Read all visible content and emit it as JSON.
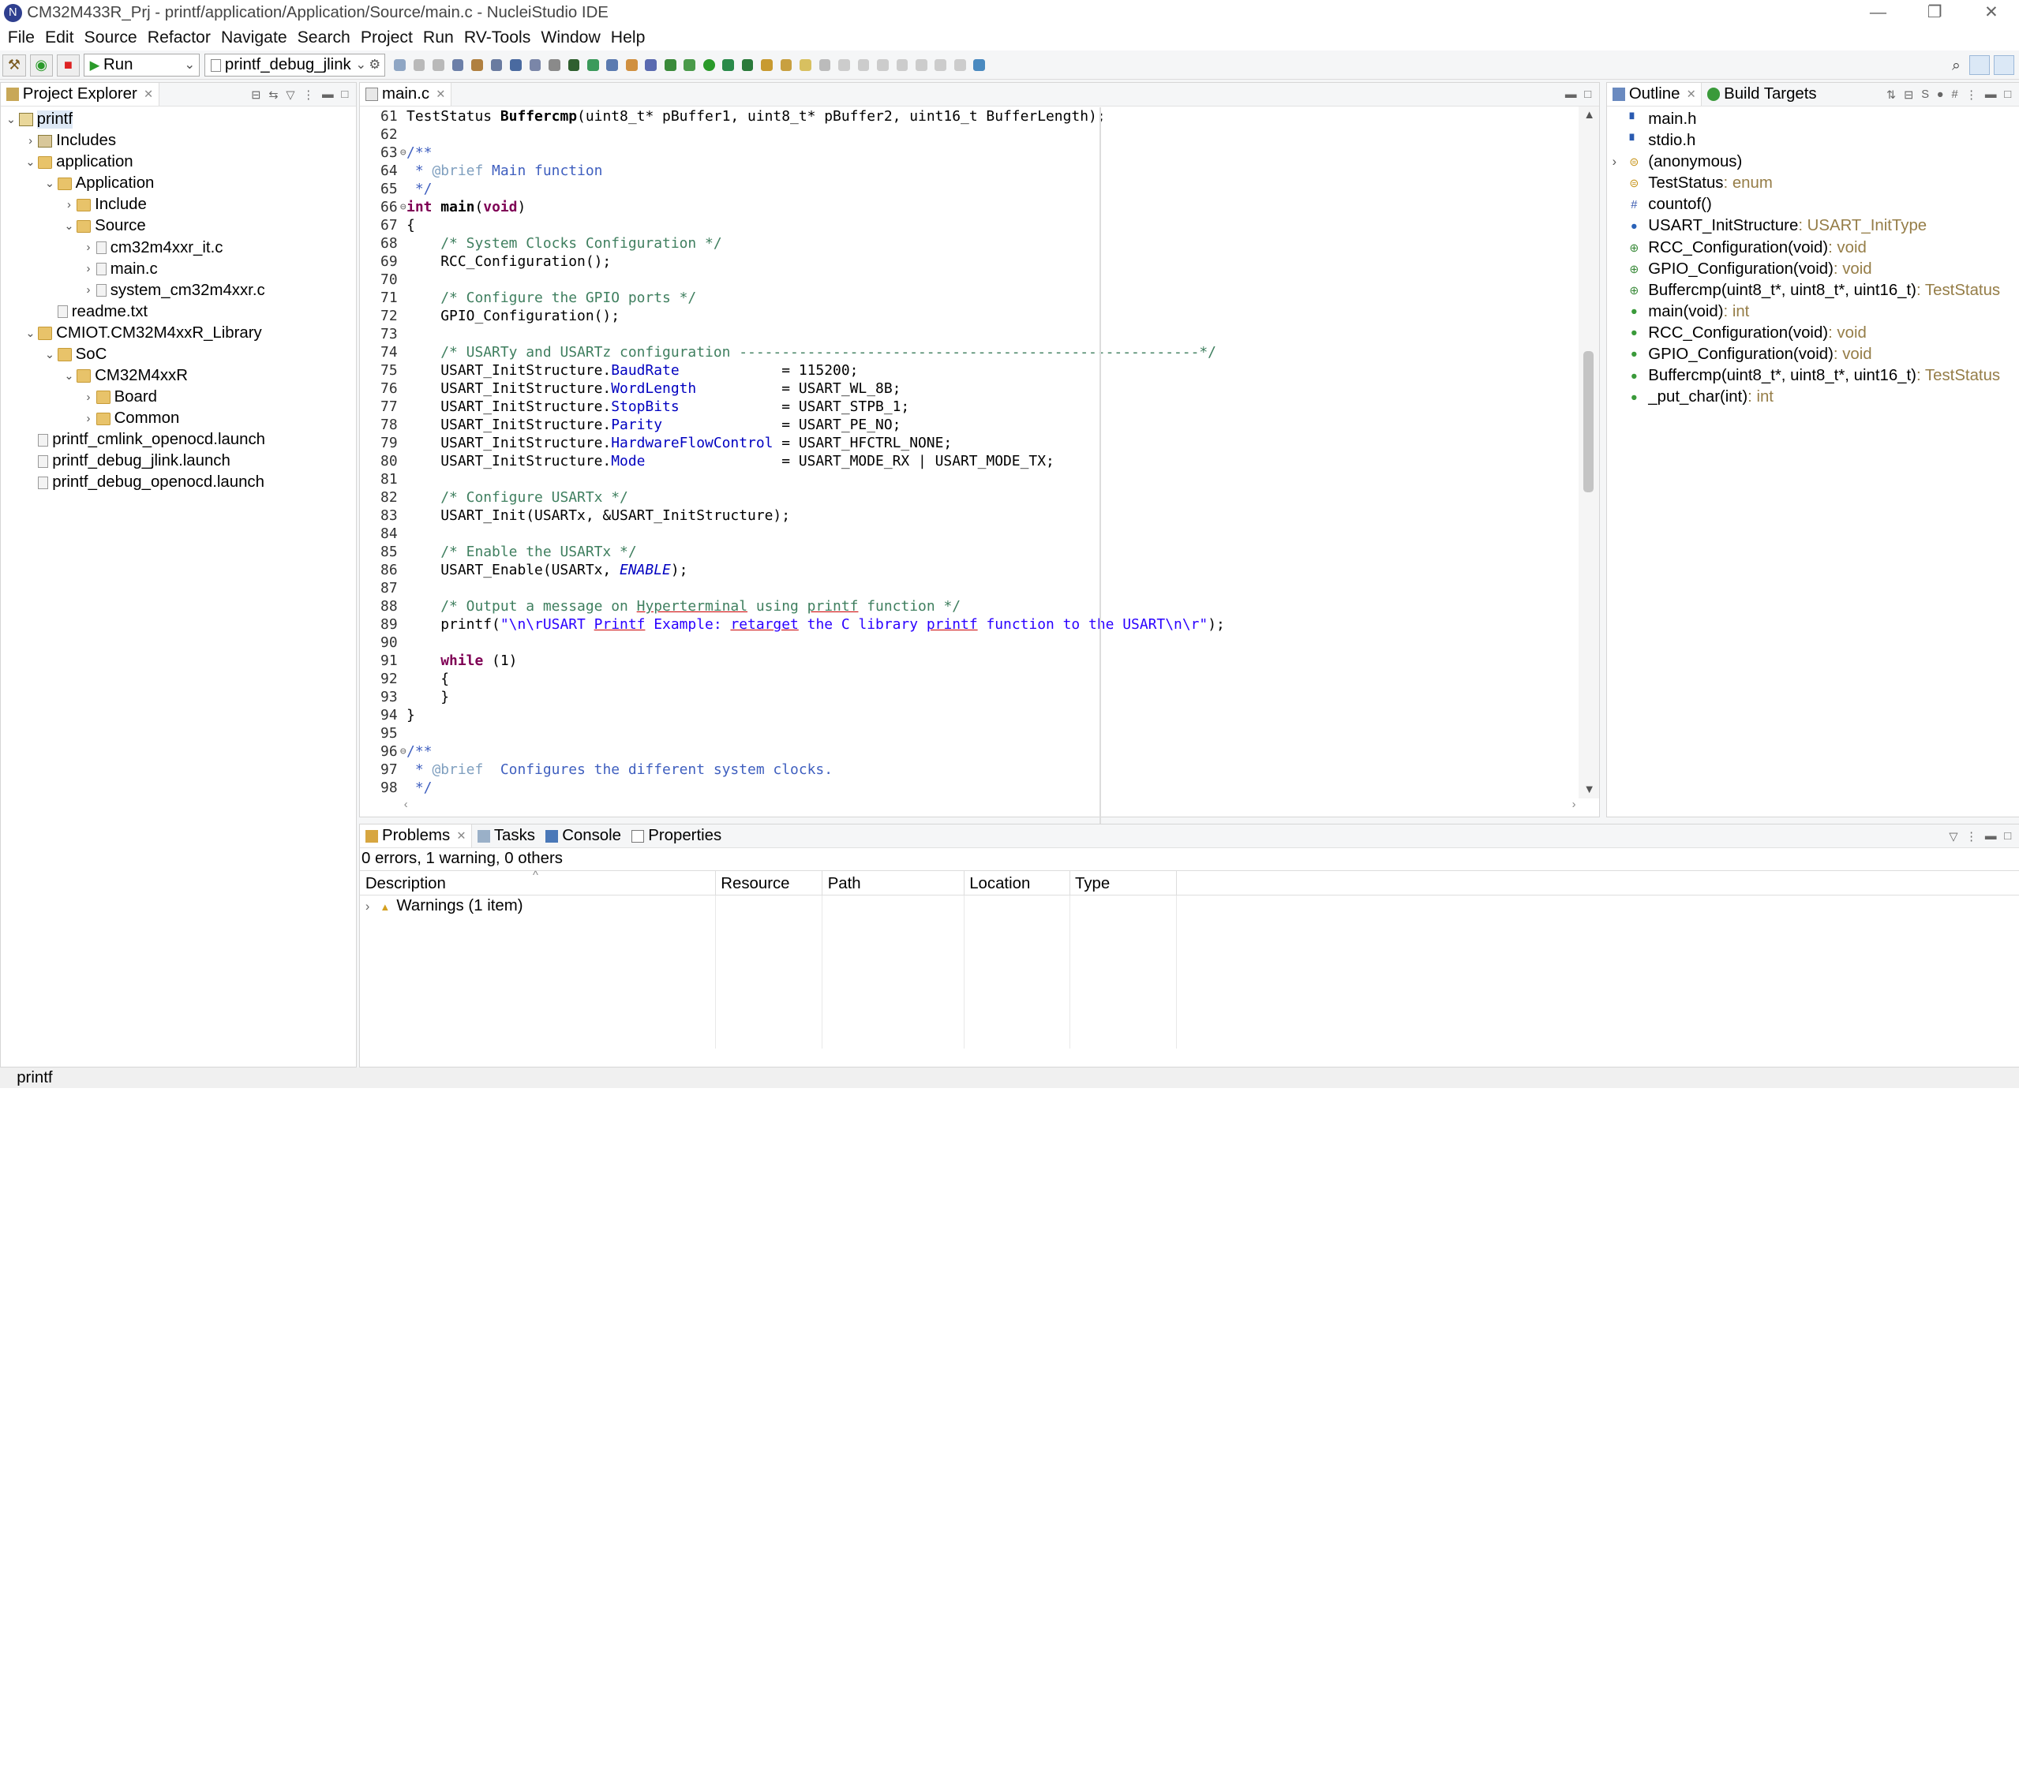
{
  "window": {
    "title": "CM32M433R_Prj - printf/application/Application/Source/main.c - NucleiStudio IDE",
    "controls": [
      "—",
      "❐",
      "✕"
    ]
  },
  "menu": [
    "File",
    "Edit",
    "Source",
    "Refactor",
    "Navigate",
    "Search",
    "Project",
    "Run",
    "RV-Tools",
    "Window",
    "Help"
  ],
  "toolbar": {
    "mode_label": "Run",
    "config_label": "printf_debug_jlink"
  },
  "project_explorer": {
    "tab_label": "Project Explorer",
    "tree": [
      {
        "label": "printf",
        "depth": 0,
        "toggle": "v",
        "icon": "proj",
        "selected": true
      },
      {
        "label": "Includes",
        "depth": 1,
        "toggle": ">",
        "icon": "incl"
      },
      {
        "label": "application",
        "depth": 1,
        "toggle": "v",
        "icon": "folder"
      },
      {
        "label": "Application",
        "depth": 2,
        "toggle": "v",
        "icon": "folder"
      },
      {
        "label": "Include",
        "depth": 3,
        "toggle": ">",
        "icon": "folder"
      },
      {
        "label": "Source",
        "depth": 3,
        "toggle": "v",
        "icon": "folder"
      },
      {
        "label": "cm32m4xxr_it.c",
        "depth": 4,
        "toggle": ">",
        "icon": "file"
      },
      {
        "label": "main.c",
        "depth": 4,
        "toggle": ">",
        "icon": "file"
      },
      {
        "label": "system_cm32m4xxr.c",
        "depth": 4,
        "toggle": ">",
        "icon": "file"
      },
      {
        "label": "readme.txt",
        "depth": 2,
        "toggle": "",
        "icon": "file"
      },
      {
        "label": "CMIOT.CM32M4xxR_Library",
        "depth": 1,
        "toggle": "v",
        "icon": "folder"
      },
      {
        "label": "SoC",
        "depth": 2,
        "toggle": "v",
        "icon": "folder"
      },
      {
        "label": "CM32M4xxR",
        "depth": 3,
        "toggle": "v",
        "icon": "folder"
      },
      {
        "label": "Board",
        "depth": 4,
        "toggle": ">",
        "icon": "folder"
      },
      {
        "label": "Common",
        "depth": 4,
        "toggle": ">",
        "icon": "folder"
      },
      {
        "label": "printf_cmlink_openocd.launch",
        "depth": 1,
        "toggle": "",
        "icon": "file"
      },
      {
        "label": "printf_debug_jlink.launch",
        "depth": 1,
        "toggle": "",
        "icon": "file"
      },
      {
        "label": "printf_debug_openocd.launch",
        "depth": 1,
        "toggle": "",
        "icon": "file"
      }
    ]
  },
  "editor": {
    "tab_label": "main.c",
    "lines": [
      {
        "n": "61",
        "f": "",
        "h": "<span>TestStatus </span><span class=\"bold\">Buffercmp</span><span>(uint8_t* pBuffer1, uint8_t* pBuffer2, uint16_t BufferLength);</span>"
      },
      {
        "n": "62",
        "f": "",
        "h": ""
      },
      {
        "n": "63",
        "f": "⊖",
        "h": "<span class=\"cm\">/**</span>"
      },
      {
        "n": "64",
        "f": "",
        "h": "<span class=\"cm\"> * <span style=\"color:#7f9fbf\">@brief</span> Main function</span>"
      },
      {
        "n": "65",
        "f": "",
        "h": "<span class=\"cm\"> */</span>"
      },
      {
        "n": "66",
        "f": "⊖",
        "h": "<span class=\"kw\">int</span> <span class=\"bold\">main</span>(<span class=\"kw\">void</span>)"
      },
      {
        "n": "67",
        "f": "",
        "h": "{"
      },
      {
        "n": "68",
        "f": "",
        "h": "    <span class=\"cmt\">/* System Clocks Configuration */</span>"
      },
      {
        "n": "69",
        "f": "",
        "h": "    RCC_Configuration();"
      },
      {
        "n": "70",
        "f": "",
        "h": ""
      },
      {
        "n": "71",
        "f": "",
        "h": "    <span class=\"cmt\">/* Configure the GPIO ports */</span>"
      },
      {
        "n": "72",
        "f": "",
        "h": "    GPIO_Configuration();"
      },
      {
        "n": "73",
        "f": "",
        "h": ""
      },
      {
        "n": "74",
        "f": "",
        "h": "    <span class=\"cmt\">/* USARTy and USARTz configuration ------------------------------------------------------*/</span>"
      },
      {
        "n": "75",
        "f": "",
        "h": "    USART_InitStructure.<span class=\"fld\">BaudRate</span>            = 115200;"
      },
      {
        "n": "76",
        "f": "",
        "h": "    USART_InitStructure.<span class=\"fld\">WordLength</span>          = USART_WL_8B;"
      },
      {
        "n": "77",
        "f": "",
        "h": "    USART_InitStructure.<span class=\"fld\">StopBits</span>            = USART_STPB_1;"
      },
      {
        "n": "78",
        "f": "",
        "h": "    USART_InitStructure.<span class=\"fld\">Parity</span>              = USART_PE_NO;"
      },
      {
        "n": "79",
        "f": "",
        "h": "    USART_InitStructure.<span class=\"fld\">HardwareFlowControl</span> = USART_HFCTRL_NONE;"
      },
      {
        "n": "80",
        "f": "",
        "h": "    USART_InitStructure.<span class=\"fld\">Mode</span>                = USART_MODE_RX | USART_MODE_TX;"
      },
      {
        "n": "81",
        "f": "",
        "h": ""
      },
      {
        "n": "82",
        "f": "",
        "h": "    <span class=\"cmt\">/* Configure USARTx */</span>"
      },
      {
        "n": "83",
        "f": "",
        "h": "    USART_Init(USARTx, &amp;USART_InitStructure);"
      },
      {
        "n": "84",
        "f": "",
        "h": ""
      },
      {
        "n": "85",
        "f": "",
        "h": "    <span class=\"cmt\">/* Enable the USARTx */</span>"
      },
      {
        "n": "86",
        "f": "",
        "h": "    USART_Enable(USARTx, <span class=\"itl\">ENABLE</span>);"
      },
      {
        "n": "87",
        "f": "",
        "h": ""
      },
      {
        "n": "88",
        "f": "",
        "h": "    <span class=\"cmt\">/* Output a message on <span class=\"ul\">Hyperterminal</span> using <span class=\"ul\">printf</span> function */</span>"
      },
      {
        "n": "89",
        "f": "",
        "h": "    printf(<span class=\"str\">\"\\n\\rUSART <span class=\"ul\">Printf</span> Example: <span class=\"ul\">retarget</span> the C library <span class=\"ul\">printf</span> function to the USART\\n\\r\"</span>);"
      },
      {
        "n": "90",
        "f": "",
        "h": ""
      },
      {
        "n": "91",
        "f": "",
        "h": "    <span class=\"kw\">while</span> (1)"
      },
      {
        "n": "92",
        "f": "",
        "h": "    {"
      },
      {
        "n": "93",
        "f": "",
        "h": "    }"
      },
      {
        "n": "94",
        "f": "",
        "h": "}"
      },
      {
        "n": "95",
        "f": "",
        "h": ""
      },
      {
        "n": "96",
        "f": "⊖",
        "h": "<span class=\"cm\">/**</span>"
      },
      {
        "n": "97",
        "f": "",
        "h": "<span class=\"cm\"> * <span style=\"color:#7f9fbf\">@brief</span>  Configures the different system clocks.</span>"
      },
      {
        "n": "98",
        "f": "",
        "h": "<span class=\"cm\"> */</span>"
      }
    ]
  },
  "outline": {
    "tab_label": "Outline",
    "tab2_label": "Build Targets",
    "items": [
      {
        "label": "main.h",
        "type": "",
        "icon": "include",
        "toggle": ""
      },
      {
        "label": "stdio.h",
        "type": "",
        "icon": "include",
        "toggle": ""
      },
      {
        "label": "(anonymous)",
        "type": "",
        "icon": "enum",
        "toggle": ">"
      },
      {
        "label": "TestStatus",
        "type": " : enum",
        "icon": "enum",
        "toggle": ""
      },
      {
        "label": "countof()",
        "type": "",
        "icon": "macro",
        "toggle": ""
      },
      {
        "label": "USART_InitStructure",
        "type": " : USART_InitType",
        "icon": "var",
        "toggle": ""
      },
      {
        "label": "RCC_Configuration(void)",
        "type": " : void",
        "icon": "decl",
        "toggle": ""
      },
      {
        "label": "GPIO_Configuration(void)",
        "type": " : void",
        "icon": "decl",
        "toggle": ""
      },
      {
        "label": "Buffercmp(uint8_t*, uint8_t*, uint16_t)",
        "type": " : TestStatus",
        "icon": "decl",
        "toggle": ""
      },
      {
        "label": "main(void)",
        "type": " : int",
        "icon": "func",
        "toggle": ""
      },
      {
        "label": "RCC_Configuration(void)",
        "type": " : void",
        "icon": "func",
        "toggle": ""
      },
      {
        "label": "GPIO_Configuration(void)",
        "type": " : void",
        "icon": "func",
        "toggle": ""
      },
      {
        "label": "Buffercmp(uint8_t*, uint8_t*, uint16_t)",
        "type": " : TestStatus",
        "icon": "func",
        "toggle": ""
      },
      {
        "label": "_put_char(int)",
        "type": " : int",
        "icon": "func",
        "toggle": ""
      }
    ]
  },
  "problems": {
    "tabs": [
      "Problems",
      "Tasks",
      "Console",
      "Properties"
    ],
    "summary": "0 errors, 1 warning, 0 others",
    "columns": [
      "Description",
      "Resource",
      "Path",
      "Location",
      "Type"
    ],
    "rows": [
      {
        "description": "Warnings (1 item)",
        "resource": "",
        "path": "",
        "location": "",
        "type": ""
      }
    ]
  },
  "status": {
    "text": "printf"
  },
  "colors": {
    "keyword": "#7f0055",
    "comment": "#3f7f5f",
    "doc_comment": "#3f5fbf",
    "field": "#0000c0",
    "string": "#2a00ff",
    "outline_type": "#957d47",
    "selection": "#dde8f5"
  }
}
